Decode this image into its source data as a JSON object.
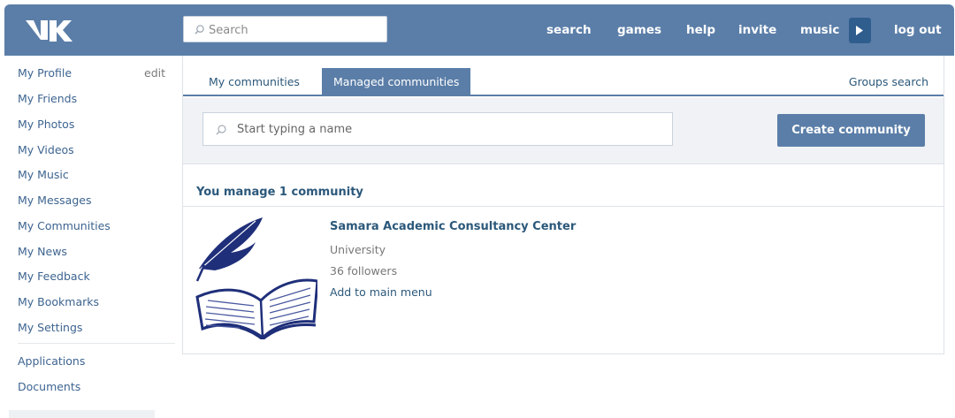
{
  "header": {
    "search_placeholder": "Search",
    "nav": [
      "search",
      "games",
      "help",
      "invite",
      "music",
      "log out"
    ]
  },
  "sidebar": {
    "edit_label": "edit",
    "items": [
      "My Profile",
      "My Friends",
      "My Photos",
      "My Videos",
      "My Music",
      "My Messages",
      "My Communities",
      "My News",
      "My Feedback",
      "My Bookmarks",
      "My Settings"
    ],
    "extra_items": [
      "Applications",
      "Documents"
    ]
  },
  "main": {
    "tabs": [
      "My communities",
      "Managed communities"
    ],
    "active_tab": "Managed communities",
    "groups_search": "Groups search",
    "name_placeholder": "Start typing a name",
    "create_button": "Create community",
    "manage_title": "You manage 1 community",
    "community": {
      "name": "Samara Academic Consultancy Center",
      "type": "University",
      "followers": "36 followers",
      "action": "Add to main menu"
    }
  },
  "colors": {
    "header_bg": "#5b7ea8",
    "link": "#2b587a",
    "button": "#5b7ea8",
    "filter_bg": "#f0f2f5"
  },
  "icons": [
    "vk-logo-icon",
    "search-icon",
    "play-icon",
    "quill-book-icon"
  ]
}
